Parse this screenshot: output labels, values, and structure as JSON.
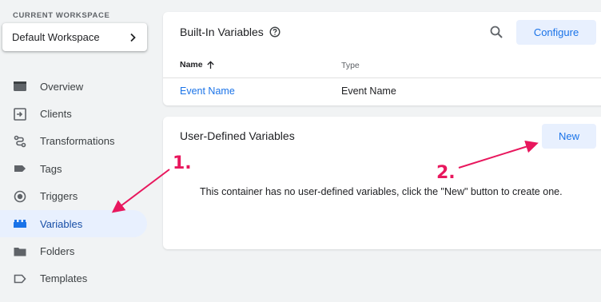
{
  "sidebar": {
    "workspace_label": "CURRENT WORKSPACE",
    "workspace_name": "Default Workspace",
    "items": [
      {
        "label": "Overview",
        "icon": "overview-icon"
      },
      {
        "label": "Clients",
        "icon": "clients-icon"
      },
      {
        "label": "Transformations",
        "icon": "transformations-icon"
      },
      {
        "label": "Tags",
        "icon": "tag-icon"
      },
      {
        "label": "Triggers",
        "icon": "trigger-icon"
      },
      {
        "label": "Variables",
        "icon": "variables-icon",
        "active": true
      },
      {
        "label": "Folders",
        "icon": "folder-icon"
      },
      {
        "label": "Templates",
        "icon": "template-icon"
      }
    ]
  },
  "builtin": {
    "title": "Built-In Variables",
    "configure_label": "Configure",
    "columns": {
      "name": "Name",
      "type": "Type"
    },
    "rows": [
      {
        "name": "Event Name",
        "type": "Event Name"
      }
    ]
  },
  "user_defined": {
    "title": "User-Defined Variables",
    "new_label": "New",
    "empty_message": "This container has no user-defined variables, click the \"New\" button to create one."
  },
  "annotations": {
    "step1": "1.",
    "step2": "2."
  },
  "colors": {
    "accent": "#1a73e8",
    "active_bg": "#e8f0fe",
    "annotation": "#e8175d"
  }
}
